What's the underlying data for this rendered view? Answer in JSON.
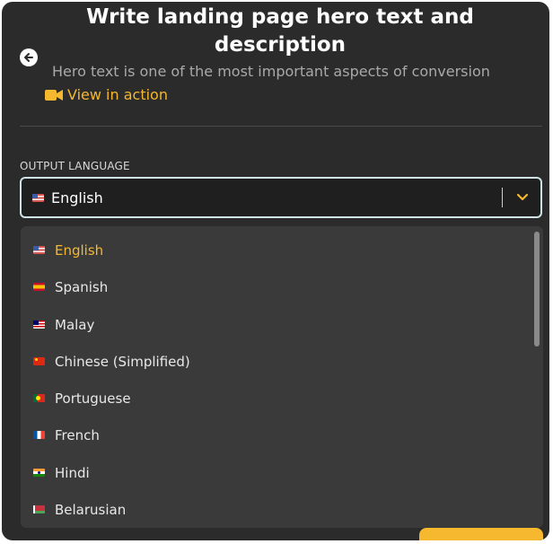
{
  "header": {
    "title": "Write landing page hero text and description",
    "subtitle": "Hero text is one of the most important aspects of conversion",
    "view_action_label": "View in action",
    "back_icon": "arrow-left-icon",
    "view_action_icon": "video-camera-icon"
  },
  "form": {
    "output_language_label": "OUTPUT LANGUAGE",
    "selected_value": "English",
    "selected_flag": "us-flag-icon",
    "chevron_icon": "chevron-down-icon"
  },
  "dropdown": {
    "options": [
      {
        "label": "English",
        "flag": "us-flag-icon",
        "selected": true
      },
      {
        "label": "Spanish",
        "flag": "spain-flag-icon",
        "selected": false
      },
      {
        "label": "Malay",
        "flag": "malaysia-flag-icon",
        "selected": false
      },
      {
        "label": "Chinese (Simplified)",
        "flag": "china-flag-icon",
        "selected": false
      },
      {
        "label": "Portuguese",
        "flag": "portugal-flag-icon",
        "selected": false
      },
      {
        "label": "French",
        "flag": "france-flag-icon",
        "selected": false
      },
      {
        "label": "Hindi",
        "flag": "india-flag-icon",
        "selected": false
      },
      {
        "label": "Belarusian",
        "flag": "belarus-flag-icon",
        "selected": false
      }
    ]
  },
  "colors": {
    "accent": "#f5b82e",
    "background": "#2b2b2b",
    "dropdown_bg": "#3a3a3a",
    "select_border": "#cfe3e6"
  }
}
